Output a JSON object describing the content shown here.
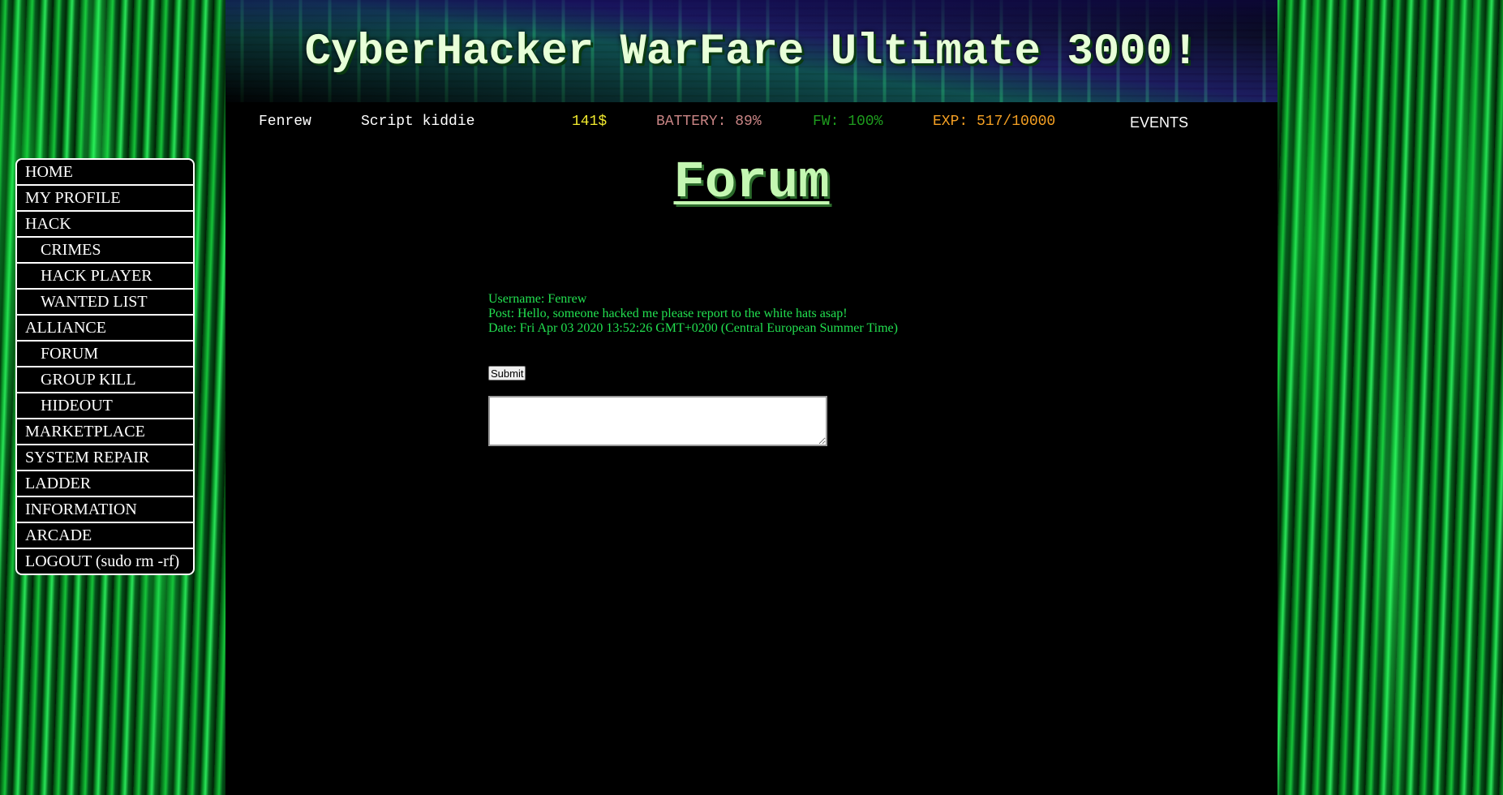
{
  "header": {
    "title": "CyberHacker WarFare Ultimate 3000!"
  },
  "stats": {
    "username": "Fenrew",
    "rank": "Script kiddie",
    "money": "141$",
    "battery": "BATTERY: 89%",
    "firewall": "FW: 100%",
    "experience": "EXP: 517/10000",
    "events": "EVENTS"
  },
  "sidebar": {
    "items": [
      {
        "label": "HOME"
      },
      {
        "label": "MY PROFILE"
      },
      {
        "label": "HACK"
      },
      {
        "label": "CRIMES"
      },
      {
        "label": "HACK PLAYER"
      },
      {
        "label": "WANTED LIST"
      },
      {
        "label": "ALLIANCE"
      },
      {
        "label": "FORUM"
      },
      {
        "label": "GROUP KILL"
      },
      {
        "label": "HIDEOUT"
      },
      {
        "label": "MARKETPLACE"
      },
      {
        "label": "SYSTEM REPAIR"
      },
      {
        "label": "LADDER"
      },
      {
        "label": "INFORMATION"
      },
      {
        "label": "ARCADE"
      },
      {
        "label": "LOGOUT (sudo rm -rf)"
      }
    ]
  },
  "main": {
    "heading": "Forum",
    "post": {
      "username": "Username: Fenrew",
      "text": "Post: Hello, someone hacked me please report to the white hats asap!",
      "date": "Date: Fri Apr 03 2020 13:52:26 GMT+0200 (Central European Summer Time)"
    },
    "submit_label": "Submit",
    "textarea_value": ""
  },
  "colors": {
    "money": "#f2ea2e",
    "battery": "#c88484",
    "firewall": "#1e9c1e",
    "experience": "#f5a023",
    "post_text": "#22e050",
    "heading": "#c4f7b2"
  }
}
